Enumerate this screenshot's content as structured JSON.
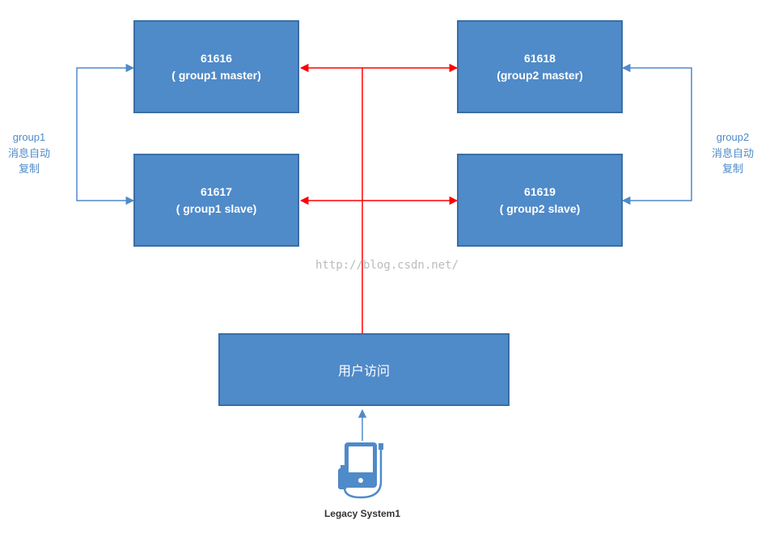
{
  "nodes": {
    "group1_master": {
      "port": "61616",
      "role": "( group1 master)"
    },
    "group2_master": {
      "port": "61618",
      "role": "(group2 master)"
    },
    "group1_slave": {
      "port": "61617",
      "role": "( group1 slave)"
    },
    "group2_slave": {
      "port": "61619",
      "role": "( group2 slave)"
    }
  },
  "labels": {
    "group1": "group1\n消息自动\n复制",
    "group2": "group2\n消息自动\n复制",
    "user_access": "用户访问",
    "legacy": "Legacy System1",
    "watermark": "http://blog.csdn.net/"
  },
  "colors": {
    "box_fill": "#4f8ac9",
    "box_border": "#3a6ea5",
    "arrow_red": "#ff0000",
    "arrow_blue": "#4f8ac9"
  }
}
